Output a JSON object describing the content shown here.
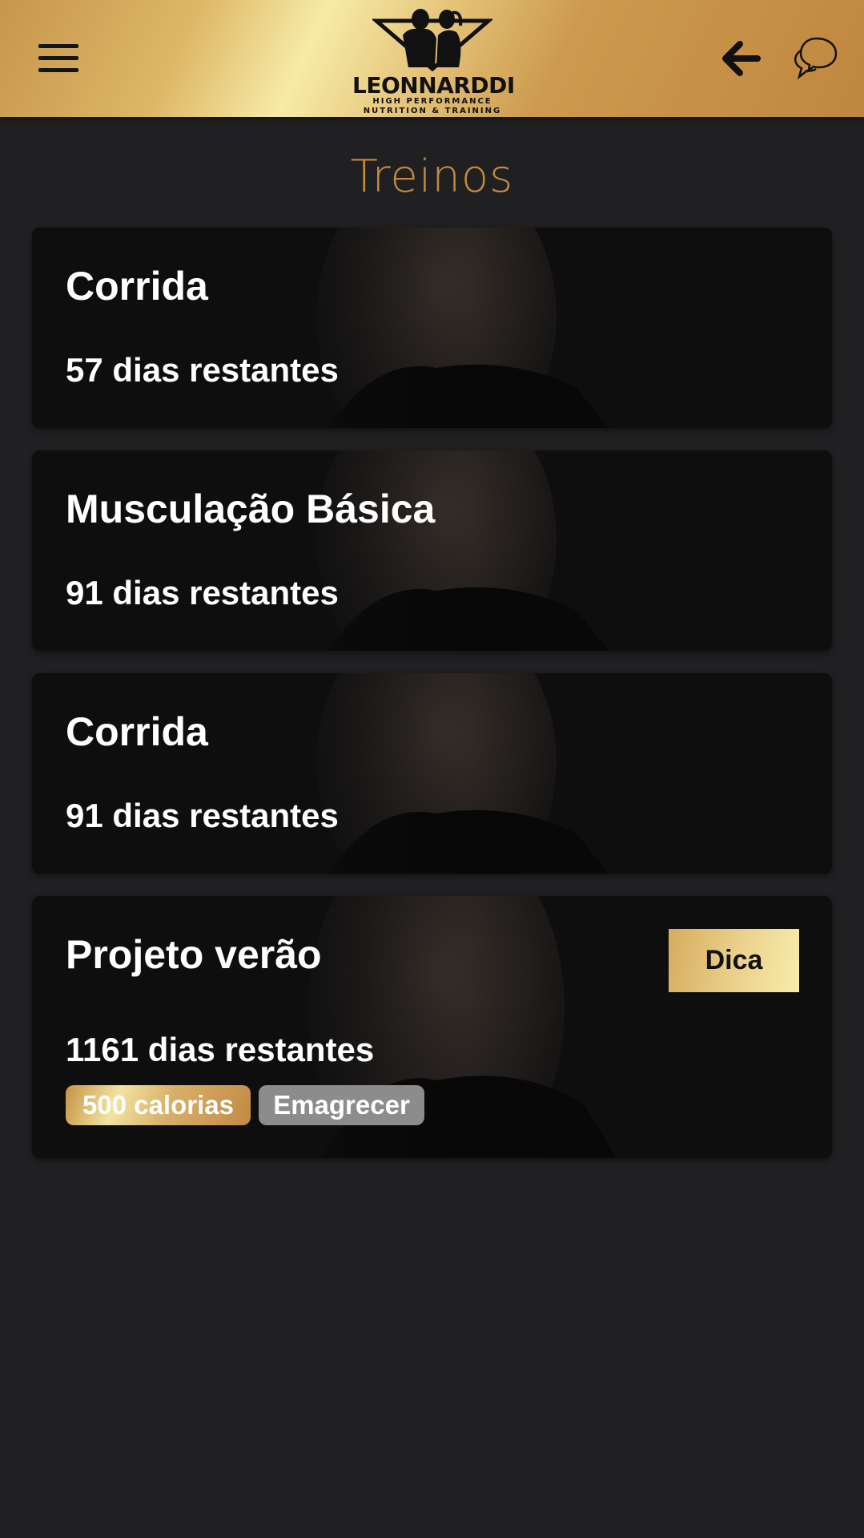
{
  "header": {
    "menu_icon": "hamburger-menu-icon",
    "logo": {
      "name": "LEONNARDDI",
      "subtitle_line1": "HIGH PERFORMANCE",
      "subtitle_line2": "NUTRITION & TRAINING"
    },
    "back_icon": "arrow-left-icon",
    "chat_icon": "chat-bubbles-icon",
    "colors": {
      "gold_light": "#f6eba7",
      "gold_dark": "#c0873f"
    }
  },
  "page": {
    "title": "Treinos",
    "title_color": "#c2893e",
    "background": "#201f21"
  },
  "workouts": [
    {
      "title": "Corrida",
      "days": "57 dias restantes"
    },
    {
      "title": "Musculação Básica",
      "days": "91 dias restantes"
    },
    {
      "title": "Corrida",
      "days": "91 dias restantes"
    },
    {
      "title": "Projeto verão",
      "days": "1161 dias restantes",
      "button": "Dica",
      "tags": [
        "500 calorias",
        "Emagrecer"
      ]
    }
  ]
}
